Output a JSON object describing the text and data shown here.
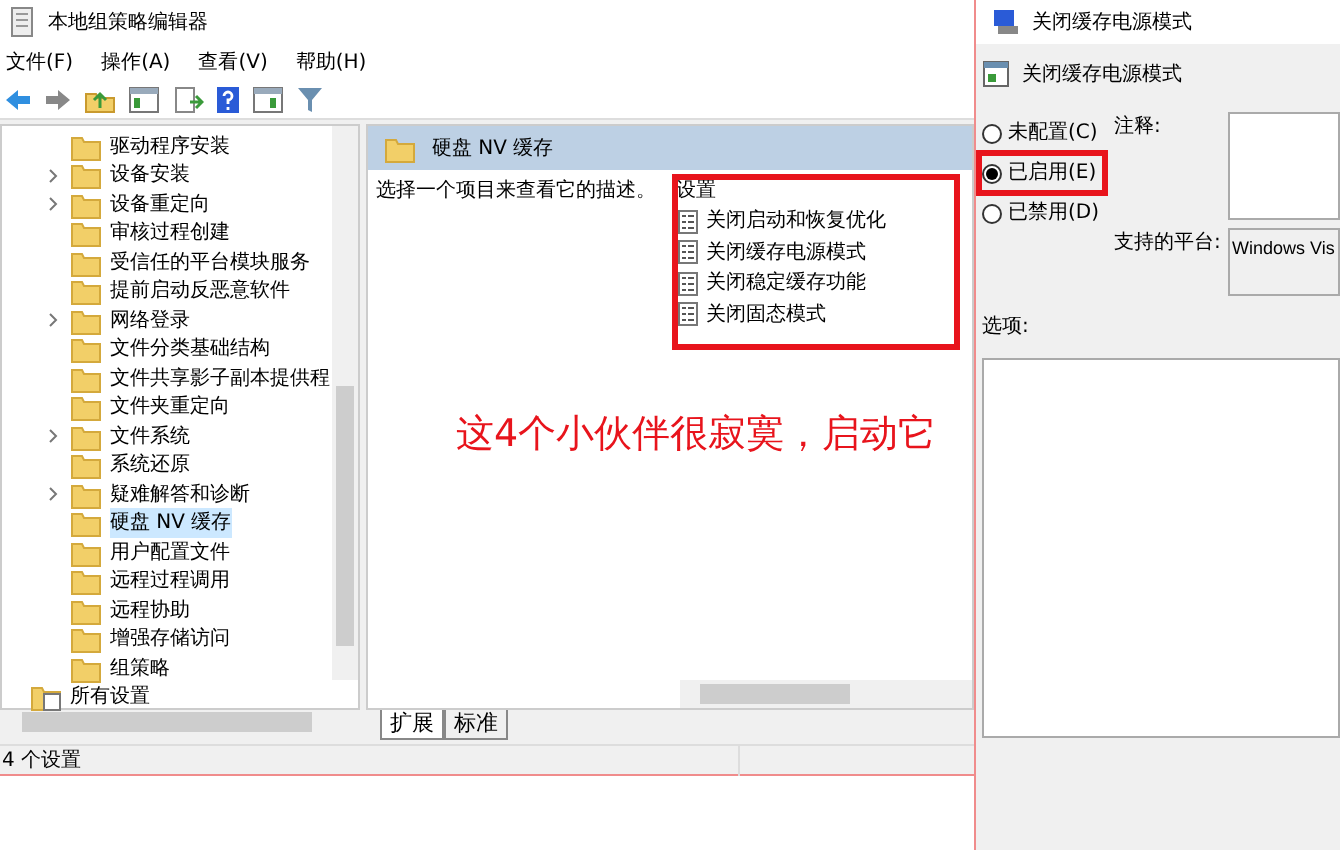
{
  "window": {
    "title": "本地组策略编辑器",
    "menu": [
      "文件(F)",
      "操作(A)",
      "查看(V)",
      "帮助(H)"
    ]
  },
  "tree": {
    "items": [
      {
        "label": "驱动程序安装",
        "kind": "folder",
        "expandable": false,
        "selected": false
      },
      {
        "label": "设备安装",
        "kind": "folder",
        "expandable": true,
        "selected": false
      },
      {
        "label": "设备重定向",
        "kind": "folder",
        "expandable": true,
        "selected": false
      },
      {
        "label": "审核过程创建",
        "kind": "folder",
        "expandable": false,
        "selected": false
      },
      {
        "label": "受信任的平台模块服务",
        "kind": "folder",
        "expandable": false,
        "selected": false
      },
      {
        "label": "提前启动反恶意软件",
        "kind": "folder",
        "expandable": false,
        "selected": false
      },
      {
        "label": "网络登录",
        "kind": "folder",
        "expandable": true,
        "selected": false
      },
      {
        "label": "文件分类基础结构",
        "kind": "folder",
        "expandable": false,
        "selected": false
      },
      {
        "label": "文件共享影子副本提供程",
        "kind": "folder",
        "expandable": false,
        "selected": false
      },
      {
        "label": "文件夹重定向",
        "kind": "folder",
        "expandable": false,
        "selected": false
      },
      {
        "label": "文件系统",
        "kind": "folder",
        "expandable": true,
        "selected": false
      },
      {
        "label": "系统还原",
        "kind": "folder",
        "expandable": false,
        "selected": false
      },
      {
        "label": "疑难解答和诊断",
        "kind": "folder",
        "expandable": true,
        "selected": false
      },
      {
        "label": "硬盘 NV 缓存",
        "kind": "folder",
        "expandable": false,
        "selected": true
      },
      {
        "label": "用户配置文件",
        "kind": "folder",
        "expandable": false,
        "selected": false
      },
      {
        "label": "远程过程调用",
        "kind": "folder",
        "expandable": false,
        "selected": false
      },
      {
        "label": "远程协助",
        "kind": "folder",
        "expandable": false,
        "selected": false
      },
      {
        "label": "增强存储访问",
        "kind": "folder",
        "expandable": false,
        "selected": false
      },
      {
        "label": "组策略",
        "kind": "folder",
        "expandable": false,
        "selected": false
      },
      {
        "label": "所有设置",
        "kind": "all-settings",
        "expandable": false,
        "selected": false
      }
    ]
  },
  "details": {
    "header": "硬盘 NV 缓存",
    "description": "选择一个项目来查看它的描述。",
    "settings_column": "设置",
    "settings": [
      "关闭启动和恢复优化",
      "关闭缓存电源模式",
      "关闭稳定缓存功能",
      "关闭固态模式"
    ],
    "tabs": [
      {
        "label": "扩展",
        "selected": true
      },
      {
        "label": "标准",
        "selected": false
      }
    ]
  },
  "status_bar": "4 个设置",
  "annotation": {
    "text": "这4个小伙伴很寂寞，启动它"
  },
  "dialog": {
    "title": "关闭缓存电源模式",
    "heading": "关闭缓存电源模式",
    "options": [
      {
        "label": "未配置(C)",
        "selected": false
      },
      {
        "label": "已启用(E)",
        "selected": true
      },
      {
        "label": "已禁用(D)",
        "selected": false
      }
    ],
    "comment_label": "注释:",
    "platform_label": "支持的平台:",
    "platform_value": "Windows Vis",
    "options_label": "选项:"
  }
}
